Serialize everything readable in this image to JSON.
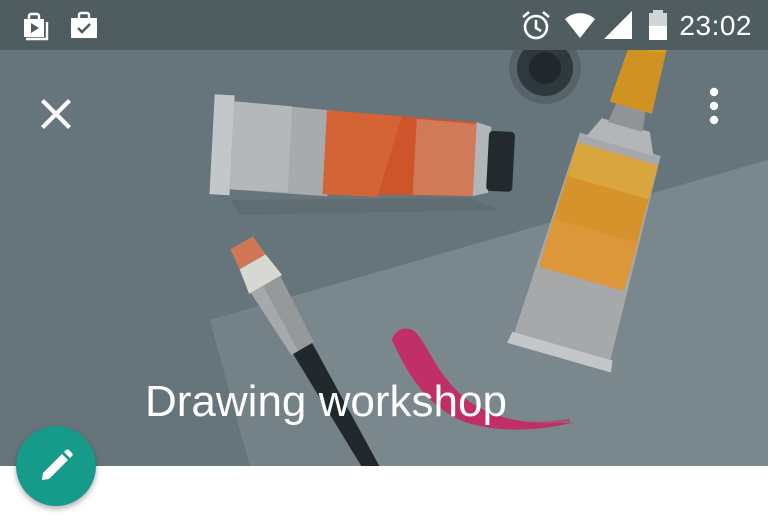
{
  "status_bar": {
    "time": "23:02",
    "left_icons": [
      "play-store-icon",
      "work-briefcase-check-icon"
    ],
    "right_icons": [
      "alarm-icon",
      "wifi-icon",
      "cell-signal-icon",
      "battery-icon"
    ]
  },
  "event": {
    "title": "Drawing workshop"
  },
  "toolbar": {
    "close_icon": "close-icon",
    "menu_icon": "more-vertical-icon"
  },
  "fab": {
    "icon": "pencil-icon"
  },
  "colors": {
    "status_bar": "#4f5d61",
    "header": "#6d7d82",
    "fab": "#169b8b"
  }
}
